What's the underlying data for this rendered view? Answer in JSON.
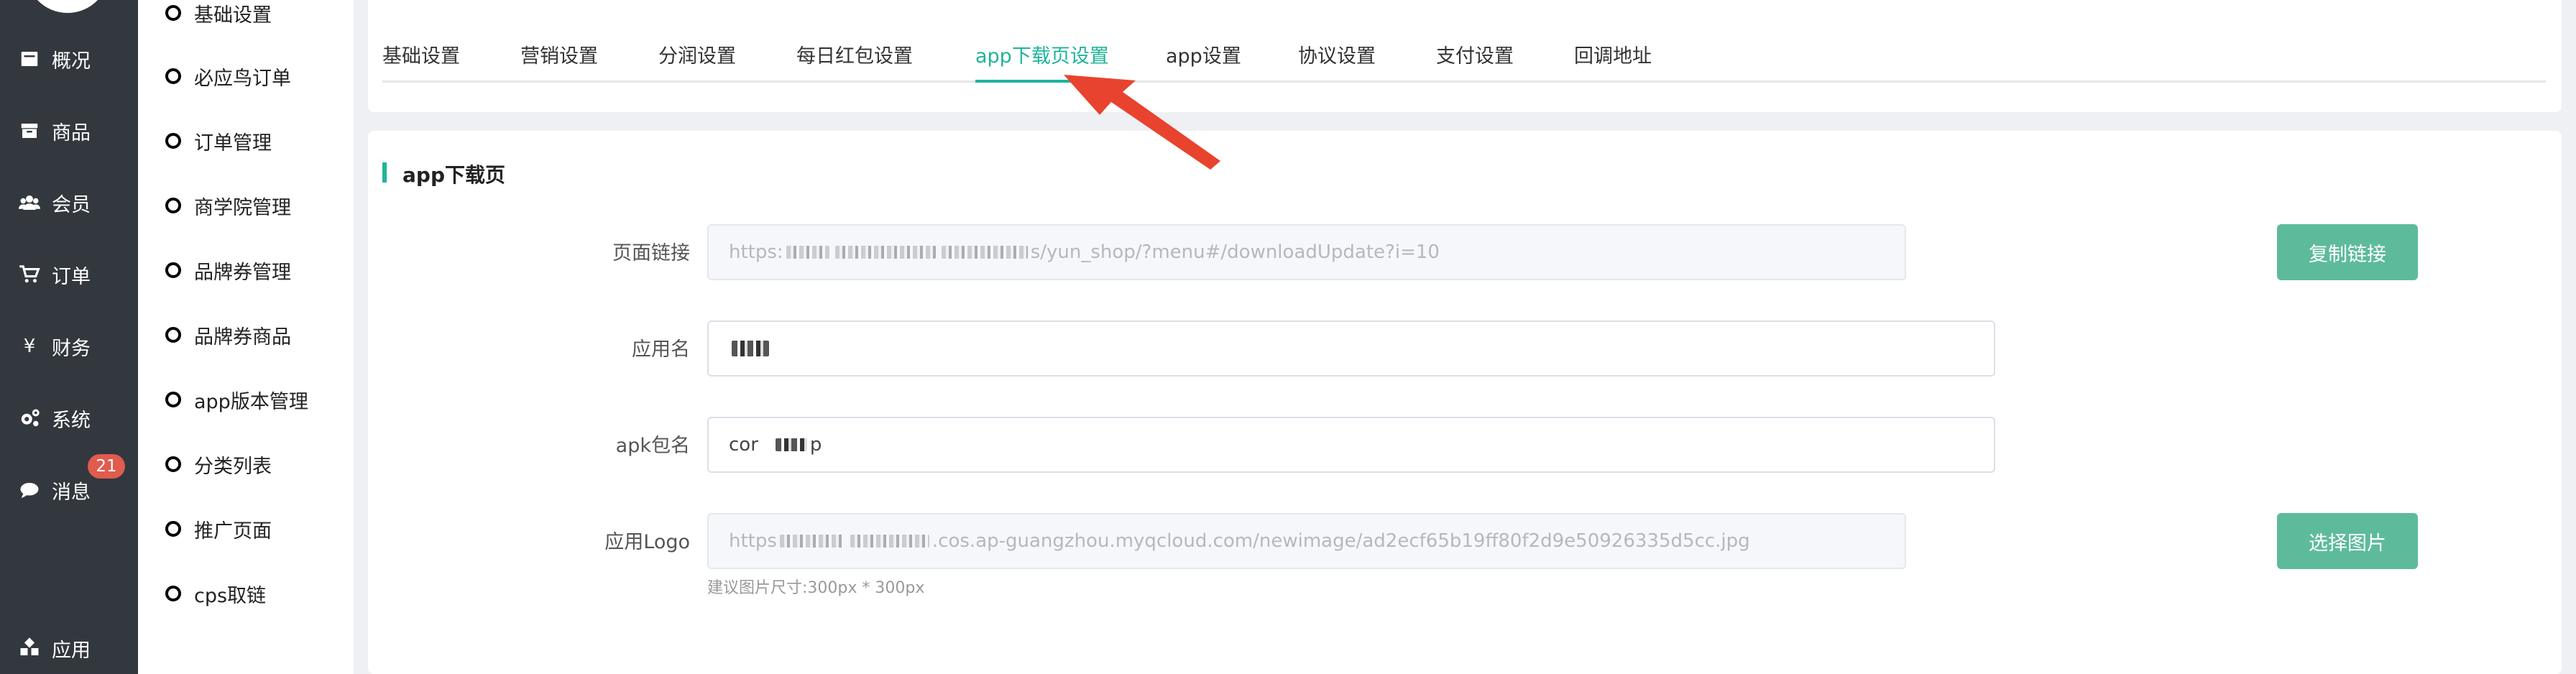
{
  "nav": {
    "items": [
      {
        "label": "概况",
        "icon": "overview-icon"
      },
      {
        "label": "商品",
        "icon": "goods-icon"
      },
      {
        "label": "会员",
        "icon": "members-icon"
      },
      {
        "label": "订单",
        "icon": "cart-icon"
      },
      {
        "label": "财务",
        "icon": "yen-icon"
      },
      {
        "label": "系统",
        "icon": "gears-icon"
      },
      {
        "label": "消息",
        "icon": "chat-icon"
      },
      {
        "label": "应用",
        "icon": "apps-icon"
      }
    ],
    "badge": "21"
  },
  "submenu": {
    "items": [
      "基础设置",
      "必应鸟订单",
      "订单管理",
      "商学院管理",
      "品牌券管理",
      "品牌券商品",
      "app版本管理",
      "分类列表",
      "推广页面",
      "cps取链"
    ]
  },
  "tabs": {
    "items": [
      "基础设置",
      "营销设置",
      "分润设置",
      "每日红包设置",
      "app下载页设置",
      "app设置",
      "协议设置",
      "支付设置",
      "回调地址"
    ],
    "active_index": 4
  },
  "section": {
    "title": "app下载页"
  },
  "form": {
    "page_link": {
      "label": "页面链接",
      "prefix": "https:",
      "suffix": "s/yun_shop/?menu#/downloadUpdate?i=10",
      "button": "复制链接"
    },
    "app_name": {
      "label": "应用名"
    },
    "apk_name": {
      "label": "apk包名",
      "prefix": "cor",
      "suffix": "p"
    },
    "logo": {
      "label": "应用Logo",
      "prefix": "https",
      "suffix": ".cos.ap-guangzhou.myqcloud.com/newimage/ad2ecf65b19ff80f2d9e50926335d5cc.jpg",
      "button": "选择图片",
      "hint": "建议图片尺寸:300px * 300px"
    }
  },
  "colors": {
    "accent": "#1fb49a",
    "button": "#5dbb9c",
    "nav_bg": "#33383e",
    "badge": "#e15b4e",
    "arrow": "#e8432e"
  }
}
